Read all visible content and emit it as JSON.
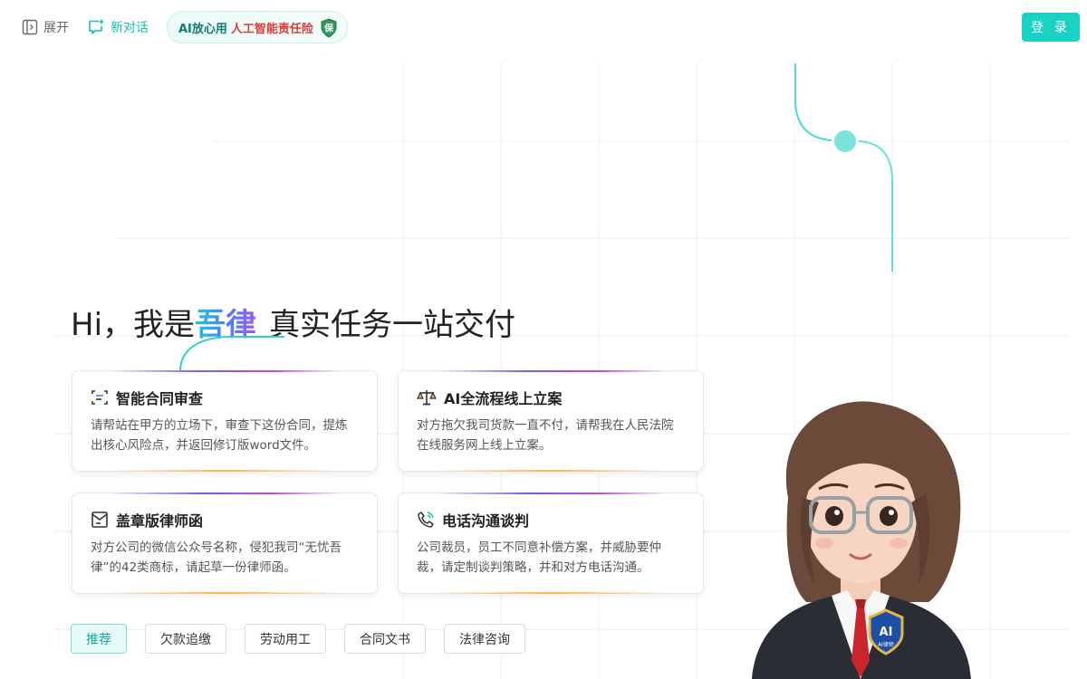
{
  "topbar": {
    "expand_label": "展开",
    "new_chat_label": "新对话",
    "badge_part1": "AI放心用",
    "badge_part2": "人工智能责任险",
    "badge_shield_text": "保",
    "login_label": "登 录"
  },
  "hero": {
    "greeting": "Hi，我是",
    "brand": "吾律",
    "tagline": "真实任务一站交付"
  },
  "cards": [
    {
      "icon": "scan-document-icon",
      "title": "智能合同审查",
      "desc": "请帮站在甲方的立场下，审查下这份合同，提炼出核心风险点，并返回修订版word文件。"
    },
    {
      "icon": "scales-icon",
      "title": "AI全流程线上立案",
      "desc": "对方拖欠我司货款一直不付，请帮我在人民法院在线服务网上线上立案。"
    },
    {
      "icon": "letter-icon",
      "title": "盖章版律师函",
      "desc": "对方公司的微信公众号名称，侵犯我司“无忧吾律”的42类商标，请起草一份律师函。"
    },
    {
      "icon": "phone-icon",
      "title": "电话沟通谈判",
      "desc": "公司裁员，员工不同意补偿方案，并威胁要仲裁，请定制谈判策略，并和对方电话沟通。"
    }
  ],
  "tabs": [
    {
      "label": "推荐",
      "active": true
    },
    {
      "label": "欠款追缴",
      "active": false
    },
    {
      "label": "劳动用工",
      "active": false
    },
    {
      "label": "合同文书",
      "active": false
    },
    {
      "label": "法律咨询",
      "active": false
    }
  ],
  "avatar": {
    "badge_text": "AI",
    "badge_sub": "AI律师"
  },
  "colors": {
    "accent": "#19d2c4",
    "accent_text": "#13a99d",
    "badge_red": "#e03a3a"
  }
}
